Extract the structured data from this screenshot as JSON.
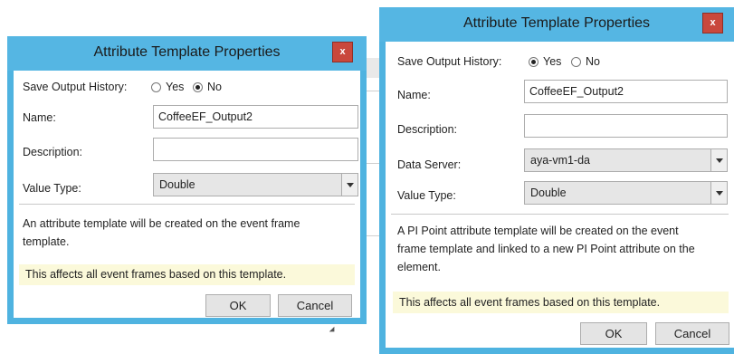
{
  "dialog_a": {
    "title": "Attribute Template Properties",
    "close_glyph": "x",
    "save_history_label": "Save Output History:",
    "yes_label": "Yes",
    "no_label": "No",
    "save_history_value": "No",
    "name_label": "Name:",
    "name_value": "CoffeeEF_Output2",
    "description_label": "Description:",
    "description_value": "",
    "value_type_label": "Value Type:",
    "value_type_value": "Double",
    "info_line1": "An attribute template will be created on the event frame",
    "info_line2": "template.",
    "warning": "This affects all event frames based on this template.",
    "ok_label": "OK",
    "cancel_label": "Cancel"
  },
  "dialog_b": {
    "title": "Attribute Template Properties",
    "close_glyph": "x",
    "save_history_label": "Save Output History:",
    "yes_label": "Yes",
    "no_label": "No",
    "save_history_value": "Yes",
    "name_label": "Name:",
    "name_value": "CoffeeEF_Output2",
    "description_label": "Description:",
    "description_value": "",
    "data_server_label": "Data Server:",
    "data_server_value": "aya-vm1-da",
    "value_type_label": "Value Type:",
    "value_type_value": "Double",
    "info_line1": "A PI Point attribute template will be created on the event",
    "info_line2": "frame template and linked to a new PI Point attribute on the",
    "info_line3": "element.",
    "warning": "This affects all event frames based on this template.",
    "ok_label": "OK",
    "cancel_label": "Cancel"
  },
  "colors": {
    "title_bar": "#55b6e3",
    "close_button": "#c9483c",
    "warning_background": "#fbf9da"
  }
}
